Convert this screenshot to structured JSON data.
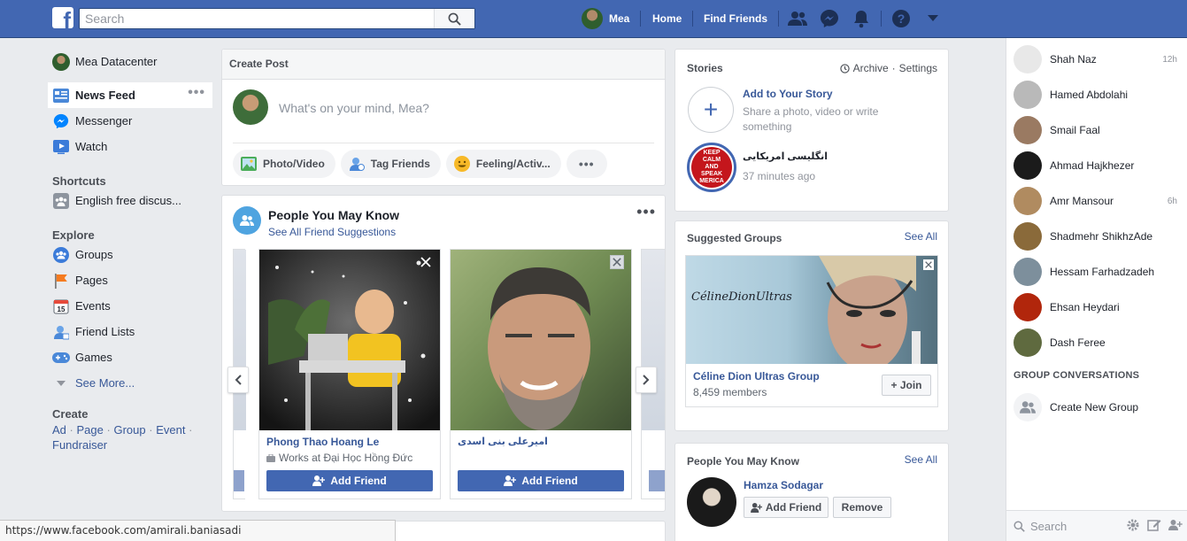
{
  "topbar": {
    "logo": "f",
    "search_placeholder": "Search",
    "profile_name": "Mea",
    "home": "Home",
    "find_friends": "Find Friends"
  },
  "left_nav": {
    "profile": "Mea Datacenter",
    "items": [
      {
        "label": "News Feed",
        "icon": "news-feed-icon"
      },
      {
        "label": "Messenger",
        "icon": "messenger-icon"
      },
      {
        "label": "Watch",
        "icon": "watch-icon"
      }
    ],
    "shortcuts_title": "Shortcuts",
    "shortcuts": [
      {
        "label": "English free discus...",
        "icon": "group-icon"
      }
    ],
    "explore_title": "Explore",
    "explore": [
      {
        "label": "Groups",
        "icon": "groups-icon"
      },
      {
        "label": "Pages",
        "icon": "flag-icon"
      },
      {
        "label": "Events",
        "icon": "calendar-icon"
      },
      {
        "label": "Friend Lists",
        "icon": "friend-list-icon"
      },
      {
        "label": "Games",
        "icon": "gamepad-icon"
      }
    ],
    "see_more": "See More...",
    "create_title": "Create",
    "create_links": [
      "Ad",
      "Page",
      "Group",
      "Event",
      "Fundraiser"
    ],
    "create_sep": "·"
  },
  "create_post": {
    "title": "Create Post",
    "placeholder": "What's on your mind, Mea?",
    "actions": [
      "Photo/Video",
      "Tag Friends",
      "Feeling/Activ..."
    ],
    "more": "•••"
  },
  "pymk": {
    "title": "People You May Know",
    "subtitle": "See All Friend Suggestions",
    "more": "•••",
    "people": [
      {
        "name": "Phong Thao Hoang Le",
        "work": "Works at Đại Học Hồng Đức",
        "button": "Add Friend"
      },
      {
        "name": "امیرعلی بنی اسدی",
        "work": "",
        "button": "Add Friend"
      }
    ]
  },
  "stories": {
    "title": "Stories",
    "archive": "Archive",
    "sep": "·",
    "settings": "Settings",
    "add_title": "Add to Your Story",
    "add_sub": "Share a photo, video or write something",
    "add_symbol": "+",
    "story_name": "انگلیسی امریکایی",
    "story_time": "37 minutes ago",
    "story_thumb_text": [
      "KEEP",
      "CALM",
      "AND",
      "SPEAK",
      "MERICA"
    ]
  },
  "suggested_groups": {
    "title": "Suggested Groups",
    "see_all": "See All",
    "photo_text": "CélineDionUltras",
    "group_name": "Céline Dion Ultras Group",
    "members": "8,459 members",
    "join": "+ Join"
  },
  "pymk_right": {
    "title": "People You May Know",
    "see_all": "See All",
    "name": "Hamza Sodagar",
    "add": "Add Friend",
    "remove": "Remove"
  },
  "chat": {
    "contacts": [
      {
        "name": "Shah Naz",
        "time": "12h",
        "color": "#e8e8e8"
      },
      {
        "name": "Hamed Abdolahi",
        "time": "",
        "color": "#b9b9b9"
      },
      {
        "name": "Smail Faal",
        "time": "",
        "color": "#9a7a62"
      },
      {
        "name": "Ahmad Hajkhezer",
        "time": "",
        "color": "#1b1b1b"
      },
      {
        "name": "Amr Mansour",
        "time": "6h",
        "color": "#b08b60"
      },
      {
        "name": "Shadmehr ShikhzAde",
        "time": "",
        "color": "#8a6a3a"
      },
      {
        "name": "Hessam Farhadzadeh",
        "time": "",
        "color": "#7d8f9c"
      },
      {
        "name": "Ehsan Heydari",
        "time": "",
        "color": "#b1260c"
      },
      {
        "name": "Dash Feree",
        "time": "",
        "color": "#5f6a3f"
      }
    ],
    "group_conversations": "GROUP CONVERSATIONS",
    "create_group": "Create New Group",
    "search_placeholder": "Search"
  },
  "status_url": "https://www.facebook.com/amirali.baniasadi",
  "colors": {
    "brand": "#4267b2",
    "link": "#385898",
    "background": "#e9ebee"
  }
}
